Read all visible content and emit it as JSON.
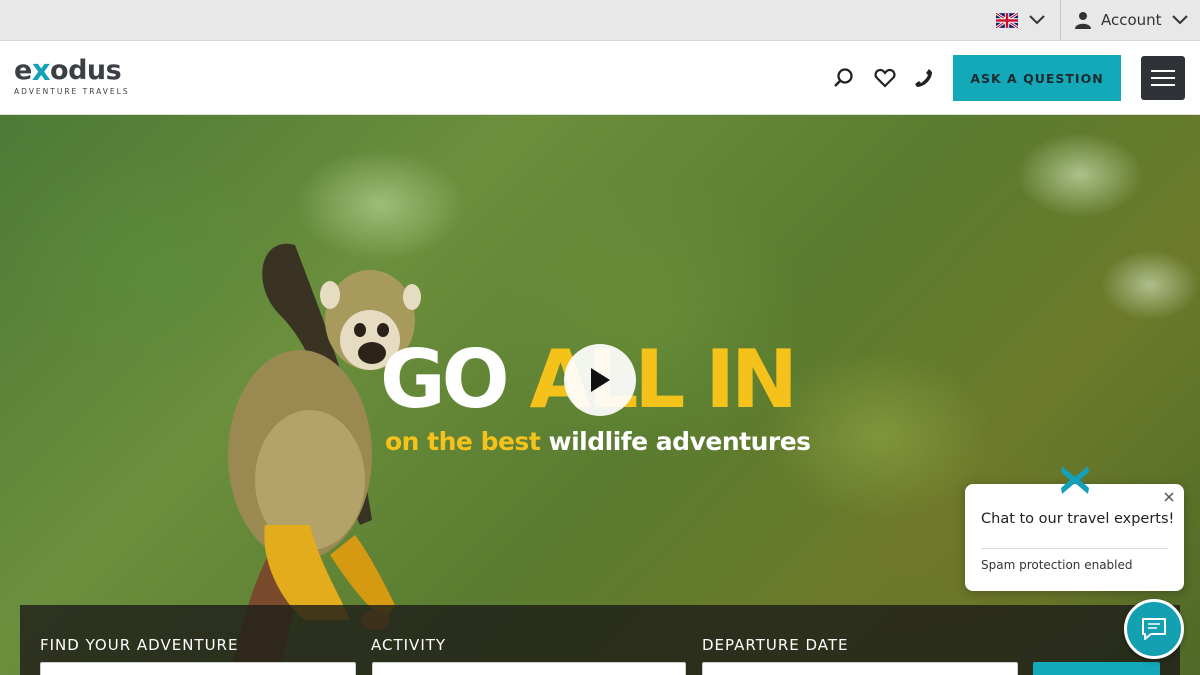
{
  "utility_bar": {
    "language_flag": "uk-flag-icon",
    "account_label": "Account"
  },
  "header": {
    "logo_text_prefix": "e",
    "logo_text_x": "x",
    "logo_text_suffix": "odus",
    "logo_tagline": "ADVENTURE TRAVELS",
    "icons": [
      "search-icon",
      "heart-icon",
      "phone-icon"
    ],
    "ask_button_label": "ASK A QUESTION",
    "menu_icon": "hamburger-menu-icon"
  },
  "hero": {
    "headline_white": "GO",
    "headline_yellow": "ALL IN",
    "subline_yellow": "on the best",
    "subline_white": "wildlife adventures",
    "play_icon": "play-icon"
  },
  "search": {
    "fields": [
      {
        "label": "FIND YOUR ADVENTURE"
      },
      {
        "label": "ACTIVITY"
      },
      {
        "label": "DEPARTURE DATE"
      }
    ]
  },
  "chat": {
    "title": "Chat to our travel experts!",
    "note": "Spam protection enabled"
  },
  "colors": {
    "brand_teal": "#13a9b8",
    "brand_yellow": "#f5c21b",
    "dark": "#2f3338"
  }
}
